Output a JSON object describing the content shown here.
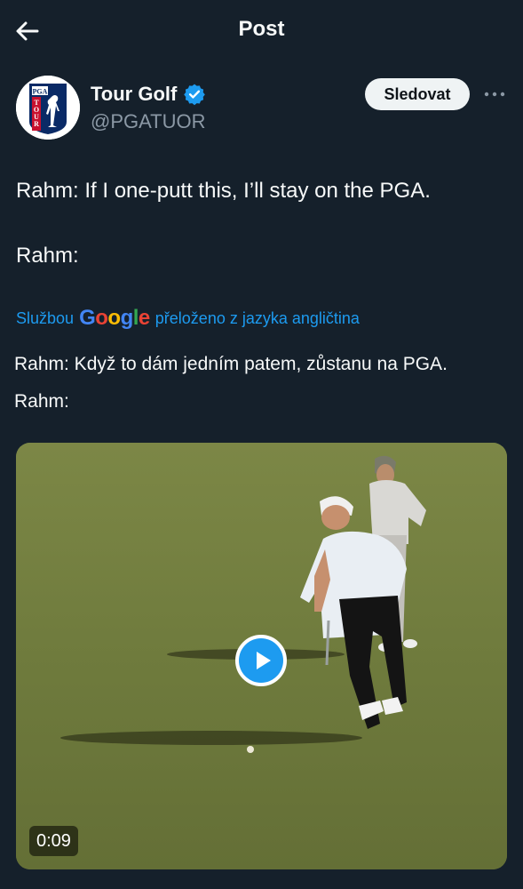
{
  "header": {
    "title": "Post",
    "back_icon": "arrow-left-icon"
  },
  "author": {
    "display_name": "Tour Golf",
    "handle": "@PGATUOR",
    "verified": true,
    "verified_color": "#1d9bf0",
    "avatar_logo_lines": [
      "PGA",
      "TOUR"
    ]
  },
  "actions": {
    "follow_label": "Sledovat",
    "more_icon": "more-dots-icon"
  },
  "tweet": {
    "line1": "Rahm: If I one-putt this, I’ll stay on the PGA.",
    "line2": "Rahm:"
  },
  "translation": {
    "prefix": "Službou",
    "service": "Google",
    "suffix": "přeloženo z jazyka angličtina",
    "line1": "Rahm: Když to dám jedním patem, zůstanu na PGA.",
    "line2": "Rahm:"
  },
  "media": {
    "duration": "0:09",
    "play_icon": "play-icon"
  },
  "colors": {
    "background": "#15202b",
    "accent": "#1d9bf0",
    "muted": "#8b98a5"
  }
}
